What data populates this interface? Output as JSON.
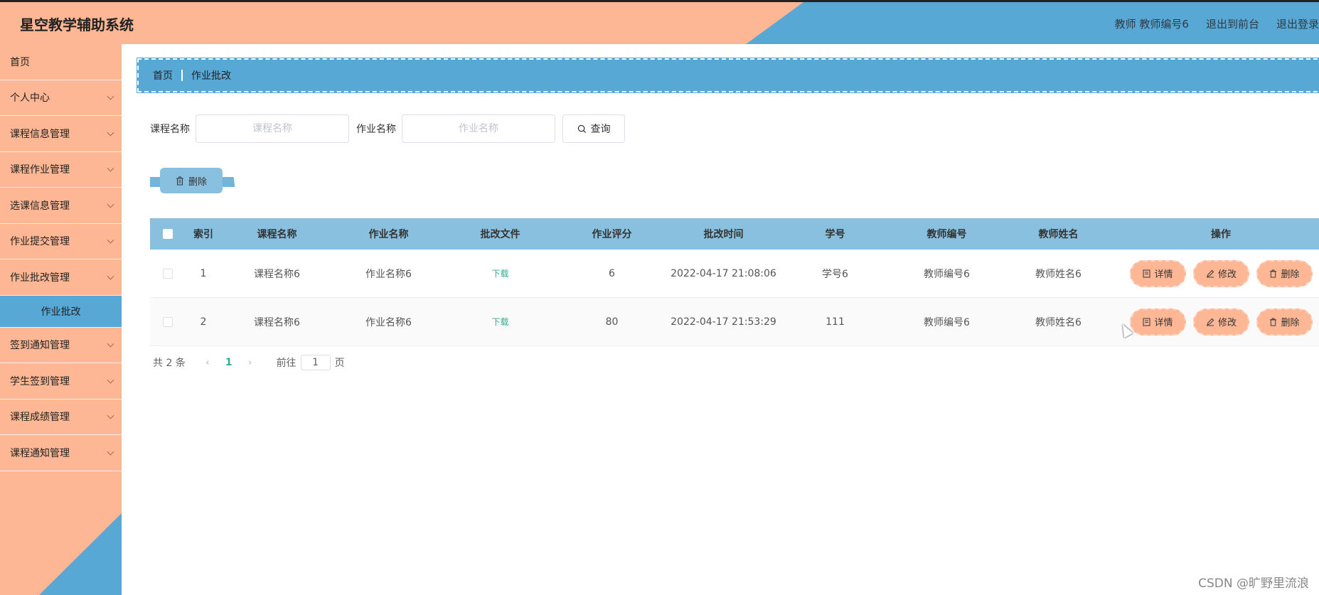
{
  "header": {
    "title": "星空教学辅助系统",
    "user_info": "教师 教师编号6",
    "to_front": "退出到前台",
    "logout": "退出登录"
  },
  "sidebar": {
    "items": [
      {
        "label": "首页",
        "has_arrow": false
      },
      {
        "label": "个人中心",
        "has_arrow": true
      },
      {
        "label": "课程信息管理",
        "has_arrow": true
      },
      {
        "label": "课程作业管理",
        "has_arrow": true
      },
      {
        "label": "选课信息管理",
        "has_arrow": true
      },
      {
        "label": "作业提交管理",
        "has_arrow": true
      },
      {
        "label": "作业批改管理",
        "has_arrow": true
      }
    ],
    "active_sub": "作业批改",
    "items_after": [
      {
        "label": "签到通知管理"
      },
      {
        "label": "学生签到管理"
      },
      {
        "label": "课程成绩管理"
      },
      {
        "label": "课程通知管理"
      }
    ]
  },
  "breadcrumb": {
    "home": "首页",
    "current": "作业批改"
  },
  "search": {
    "course_label": "课程名称",
    "course_placeholder": "课程名称",
    "hw_label": "作业名称",
    "hw_placeholder": "作业名称",
    "query_label": "查询"
  },
  "bulk_delete_label": "删除",
  "table": {
    "headers": [
      "索引",
      "课程名称",
      "作业名称",
      "批改文件",
      "作业评分",
      "批改时间",
      "学号",
      "教师编号",
      "教师姓名",
      "操作"
    ],
    "rows": [
      {
        "index": "1",
        "course": "课程名称6",
        "homework": "作业名称6",
        "file": "下载",
        "score": "6",
        "time": "2022-04-17 21:08:06",
        "student_no": "学号6",
        "teacher_no": "教师编号6",
        "teacher_name": "教师姓名6"
      },
      {
        "index": "2",
        "course": "课程名称6",
        "homework": "作业名称6",
        "file": "下载",
        "score": "80",
        "time": "2022-04-17 21:53:29",
        "student_no": "111",
        "teacher_no": "教师编号6",
        "teacher_name": "教师姓名6"
      }
    ],
    "actions": {
      "detail": "详情",
      "edit": "修改",
      "delete": "删除"
    }
  },
  "pagination": {
    "total": "共 2 条",
    "current_page": "1",
    "goto_prefix": "前往",
    "goto_value": "1",
    "goto_suffix": "页"
  },
  "watermark": "CSDN @旷野里流浪",
  "colors": {
    "peach": "#fdb794",
    "blue": "#58a8d5",
    "table_header": "#89c0df",
    "link_green": "#2fae8d"
  }
}
